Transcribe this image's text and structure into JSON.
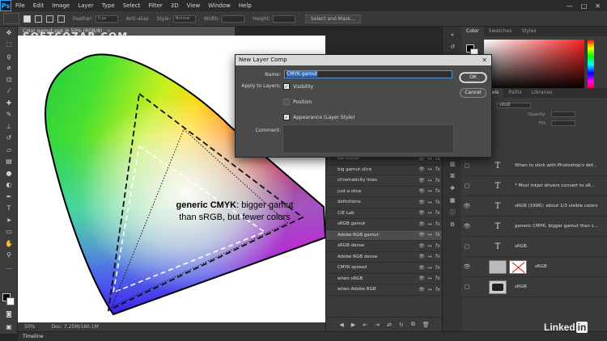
{
  "app": {
    "logo": "Ps",
    "menu": [
      "File",
      "Edit",
      "Image",
      "Layer",
      "Type",
      "Select",
      "Filter",
      "3D",
      "View",
      "Window",
      "Help"
    ],
    "window_controls": [
      "—",
      "□",
      "✕"
    ]
  },
  "options_bar": {
    "feather_label": "Feather:",
    "feather_value": "0 px",
    "antialias_label": "Anti-alias",
    "style_label": "Style:",
    "style_value": "Normal",
    "width_label": "Width:",
    "height_label": "Height:",
    "select_mask_label": "Select and Mask..."
  },
  "watermark": {
    "line1": "SOFTCOZAR.COM",
    "line2": "اولین دانشنامه نرم افزار ایران"
  },
  "document": {
    "tab_title": "Color gamut.psd @ 50% (RGB/8)",
    "zoom": "50%",
    "doc_size": "Doc: 7.25M/160.1M",
    "canvas_text_bold": "generic CMYK",
    "canvas_text_rest": ": bigger gamut",
    "canvas_text_line2": "than sRGB, but fewer colors"
  },
  "dialog": {
    "title": "New Layer Comp",
    "name_label": "Name:",
    "name_value": "CMYK gamut",
    "apply_label": "Apply to Layers:",
    "visibility_label": "Visibility",
    "position_label": "Position",
    "appearance_label": "Appearance (Layer Style)",
    "comment_label": "Comment:",
    "ok_label": "OK",
    "cancel_label": "Cancel",
    "visibility_checked": true,
    "position_checked": false,
    "appearance_checked": true
  },
  "layer_comps": {
    "items": [
      {
        "label": "sat in/out"
      },
      {
        "label": "big gamut slice"
      },
      {
        "label": "chromaticity lines"
      },
      {
        "label": "just a slice"
      },
      {
        "label": "definitions"
      },
      {
        "label": "CIE Lab"
      },
      {
        "label": "sRGB gamut"
      },
      {
        "label": "Adobe RGB gamut"
      },
      {
        "label": "sRGB dense"
      },
      {
        "label": "Adobe RGB dense"
      },
      {
        "label": "CMYK spread"
      },
      {
        "label": "when sRGB"
      },
      {
        "label": "when Adobe RGB"
      }
    ],
    "selected_index": 7,
    "footer_icons": [
      "◀",
      "▶",
      "⇤",
      "⇥",
      "⇄",
      "↻",
      "⧉",
      "🗑"
    ]
  },
  "color_panel": {
    "tabs": [
      "Color",
      "Swatches",
      "Styles"
    ],
    "accent": "#ff2020"
  },
  "layers_panel": {
    "tabs": [
      "nels",
      "Paths",
      "Libraries"
    ],
    "kind_value": "sRGB",
    "opacity_label": "Opacity:",
    "fill_label": "Fill:",
    "layers": [
      {
        "type": "text",
        "name": "When to stick with Photoshop's def...",
        "visible": false
      },
      {
        "type": "text",
        "name": "* Most inkjet drivers convert to sR...",
        "visible": false
      },
      {
        "type": "text",
        "name": "sRGB (1996): about 1/3 visible colors",
        "visible": true
      },
      {
        "type": "text",
        "name": "generic CMYK: bigger gamut than s...",
        "visible": true
      },
      {
        "type": "text",
        "name": "sRGB",
        "visible": false
      },
      {
        "type": "image-red",
        "name": "sRGB",
        "visible": true
      },
      {
        "type": "image-dark",
        "name": "sRGB",
        "visible": false
      }
    ]
  },
  "timeline": {
    "label": "Timeline"
  },
  "branding": {
    "linked": "Linked",
    "in": "in"
  }
}
